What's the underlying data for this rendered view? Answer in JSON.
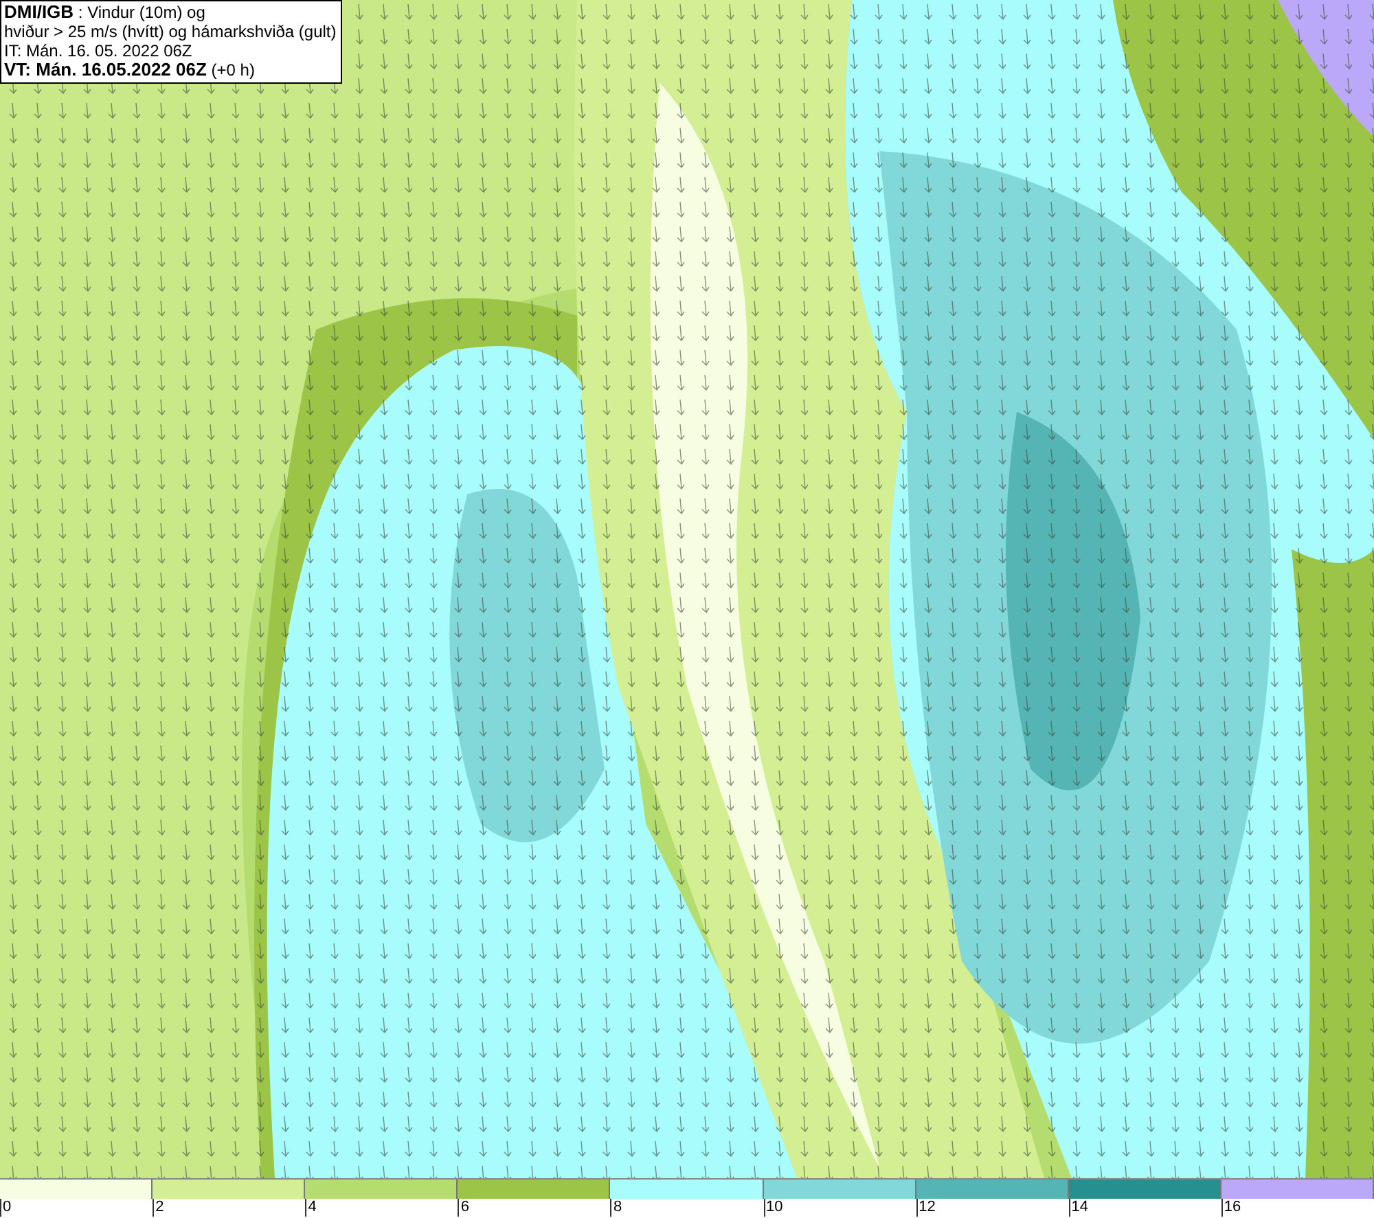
{
  "header": {
    "lines": [
      "**DMI/IGB** : Vindur (10m) og",
      "hviður > 25 m/s (hvítt) og hámarkshviða (gult)",
      "IT: Mán. 16. 05. 2022 06Z",
      "**VT: Mán. 16.05.2022 06Z** (+0 h)"
    ]
  },
  "legend": [
    {
      "label": "0",
      "color": "#f7fde0"
    },
    {
      "label": "2",
      "color": "#d4ee94"
    },
    {
      "label": "4",
      "color": "#b5dc6e"
    },
    {
      "label": "6",
      "color": "#9cc446"
    },
    {
      "label": "8",
      "color": "#a8fcfc"
    },
    {
      "label": "10",
      "color": "#82d8d8"
    },
    {
      "label": "12",
      "color": "#55b4b4"
    },
    {
      "label": "14",
      "color": "#269090"
    },
    {
      "label": "16",
      "color": "#bba8f8"
    }
  ]
}
